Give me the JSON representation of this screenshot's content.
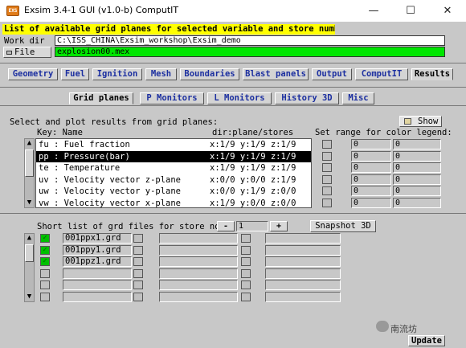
{
  "window": {
    "title": "Exsim 3.4-1 GUI (v1.0-b) ComputIT",
    "app_icon": "exsim-app-icon",
    "controls": [
      "minimize",
      "maximize",
      "close"
    ]
  },
  "status_message": "List of available grid planes for selected variable and store number.",
  "workdir": {
    "label": "Work dir",
    "value": "C:\\ISS_CHINA\\Exsim_workshop\\Exsim_demo"
  },
  "file": {
    "button_label": "File",
    "value": "explosion00.mex"
  },
  "main_tabs": [
    {
      "label": "Geometry",
      "active": false
    },
    {
      "label": "Fuel",
      "active": false
    },
    {
      "label": "Ignition",
      "active": false
    },
    {
      "label": "Mesh",
      "active": false
    },
    {
      "label": "Boundaries",
      "active": false
    },
    {
      "label": "Blast panels",
      "active": false
    },
    {
      "label": "Output",
      "active": false
    },
    {
      "label": "ComputIT",
      "active": false
    },
    {
      "label": "Results",
      "active": true
    }
  ],
  "sub_tabs": [
    {
      "label": "Grid planes",
      "active": true
    },
    {
      "label": "P Monitors",
      "active": false
    },
    {
      "label": "L Monitors",
      "active": false
    },
    {
      "label": "History 3D",
      "active": false
    },
    {
      "label": "Misc",
      "active": false
    }
  ],
  "grid_section": {
    "title": "Select and plot results from grid planes:",
    "show_label": "Show",
    "col_key_name": "Key: Name",
    "col_dir": "dir:plane/stores",
    "col_range": "Set range for color legend:",
    "rows": [
      {
        "name": "fu : Fuel fraction",
        "loc": "x:1/9 y:1/9 z:1/9",
        "selected": false,
        "min": "0",
        "max": "0"
      },
      {
        "name": "pp : Pressure(bar)",
        "loc": "x:1/9 y:1/9 z:1/9",
        "selected": true,
        "min": "0",
        "max": "0"
      },
      {
        "name": "te : Temperature",
        "loc": "x:1/9 y:1/9 z:1/9",
        "selected": false,
        "min": "0",
        "max": "0"
      },
      {
        "name": "uv : Velocity vector z-plane",
        "loc": "x:0/0 y:0/0 z:1/9",
        "selected": false,
        "min": "0",
        "max": "0"
      },
      {
        "name": "uw : Velocity vector y-plane",
        "loc": "x:0/0 y:1/9 z:0/0",
        "selected": false,
        "min": "0",
        "max": "0"
      },
      {
        "name": "vw : Velocity vector x-plane",
        "loc": "x:1/9 y:0/0 z:0/0",
        "selected": false,
        "min": "0",
        "max": "0"
      }
    ]
  },
  "short_list": {
    "label": "Short list of grd files for store no:",
    "minus": "-",
    "plus": "+",
    "store_no": "1",
    "snapshot_label": "Snapshot 3D",
    "files": [
      {
        "name": "001ppx1.grd",
        "checked": true
      },
      {
        "name": "001ppy1.grd",
        "checked": true
      },
      {
        "name": "001ppz1.grd",
        "checked": true
      },
      {
        "name": "",
        "checked": false
      },
      {
        "name": "",
        "checked": false
      },
      {
        "name": "",
        "checked": false
      }
    ]
  },
  "update_label": "Update",
  "watermark": "南流坊",
  "colors": {
    "status_bg": "#ffff00",
    "file_bg": "#00e600",
    "tab_text": "#1c2fa0",
    "client_bg": "#c8c8c8"
  }
}
